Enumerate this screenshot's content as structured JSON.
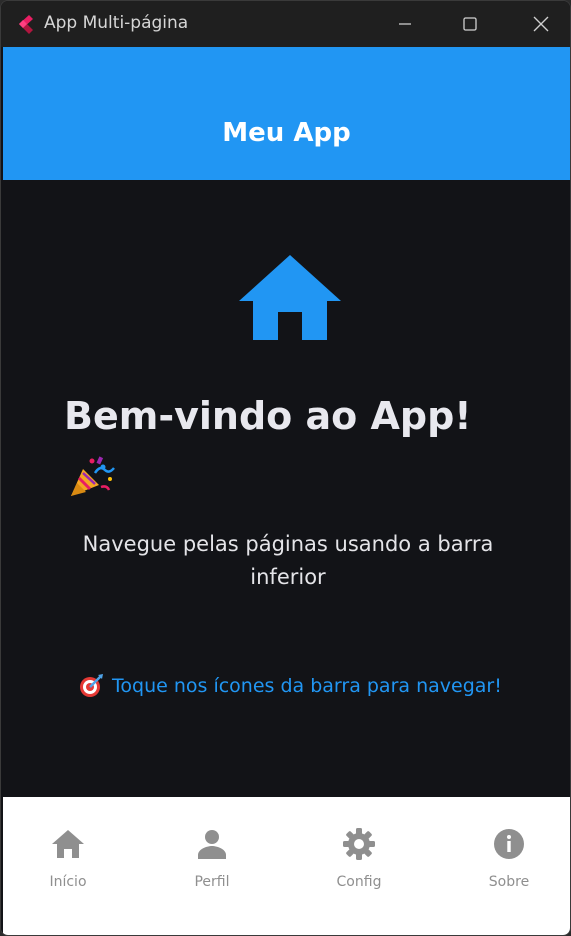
{
  "window": {
    "title": "App Multi-página",
    "icons": {
      "app": "flutter-logo-icon",
      "minimize": "minimize-icon",
      "maximize": "maximize-icon",
      "close": "close-icon"
    }
  },
  "app_bar": {
    "title": "Meu App"
  },
  "main": {
    "icon": "home-icon",
    "welcome": "Bem-vindo ao App!",
    "celebration_emoji": "party-popper-icon",
    "subtitle": "Navegue pelas páginas usando a barra inferior",
    "hint_icon": "target-icon",
    "hint": "Toque nos ícones da barra para navegar!"
  },
  "bottom_nav": {
    "items": [
      {
        "label": "Início",
        "icon": "home-icon"
      },
      {
        "label": "Perfil",
        "icon": "person-icon"
      },
      {
        "label": "Config",
        "icon": "gear-icon"
      },
      {
        "label": "Sobre",
        "icon": "info-icon"
      }
    ]
  },
  "colors": {
    "accent": "#2196f3",
    "background": "#121317",
    "nav_background": "#ffffff",
    "nav_inactive": "#8f8f8f",
    "text": "#e8e8ee"
  }
}
